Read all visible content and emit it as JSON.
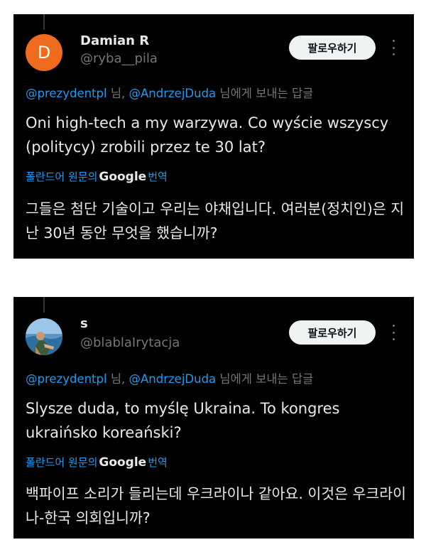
{
  "tweets": [
    {
      "avatar_letter": "D",
      "avatar_color": "#ef6c1f",
      "display_name": "Damian R",
      "handle": "@ryba__pila",
      "follow_label": "팔로우하기",
      "reply_mention1": "@prezydentpl",
      "reply_sep": " 님, ",
      "reply_mention2": "@AndrzejDuda",
      "reply_suffix": " 님에게 보내는 답글",
      "text": "Oni high-tech a my warzywa. Co wyście wszyscy (politycy) zrobili przez te 30 lat?",
      "translate_prefix": "폴란드어 원문의",
      "translate_brand": "Google",
      "translate_suffix": "번역",
      "translated_text": "그들은 첨단 기술이고 우리는 야채입니다. 여러분(정치인)은 지난 30년 동안 무엇을 했습니까?"
    },
    {
      "avatar_letter": "",
      "display_name": "s",
      "handle": "@blablaIrytacja",
      "follow_label": "팔로우하기",
      "reply_mention1": "@prezydentpl",
      "reply_sep": " 님, ",
      "reply_mention2": "@AndrzejDuda",
      "reply_suffix": " 님에게 보내는 답글",
      "text": "Slysze duda, to myślę Ukraina. To kongres ukraińsko koreański?",
      "translate_prefix": "폴란드어 원문의",
      "translate_brand": "Google",
      "translate_suffix": "번역",
      "translated_text": "백파이프 소리가 들리는데 우크라이나 같아요. 이것은 우크라이나-한국 의회입니까?"
    }
  ],
  "colors": {
    "background": "#000000",
    "text": "#e7e9ea",
    "muted": "#71767b",
    "link": "#1d9bf0",
    "button_bg": "#eff3f4"
  }
}
